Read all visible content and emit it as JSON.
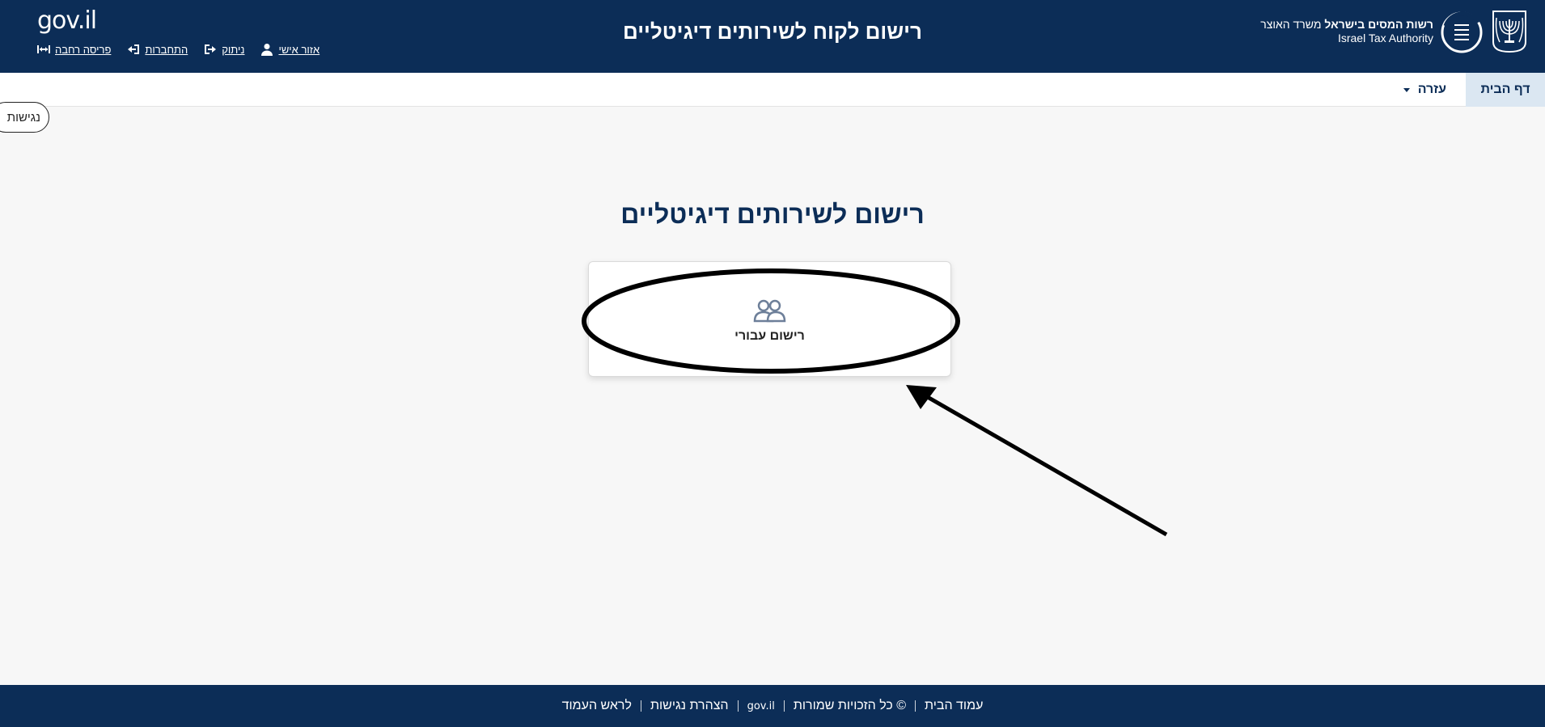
{
  "header": {
    "title": "רישום לקוח לשירותים דיגיטליים",
    "authority_he_bold": "רשות המסים בישראל",
    "authority_he_rest": "משרד האוצר",
    "authority_en": "Israel Tax Authority",
    "logo_text": "gov.il",
    "links": {
      "personal_area": "אזור אישי",
      "logout": "ניתוק",
      "login": "התחברות",
      "wide_layout": "פריסה רחבה"
    }
  },
  "nav": {
    "home": "דף הבית",
    "help": "עזרה"
  },
  "accessibility_button": "נגישות",
  "main": {
    "title": "רישום לשירותים דיגיטליים",
    "card_label": "רישום עבורי"
  },
  "footer": {
    "home": "עמוד הבית",
    "copyright": "© כל הזכויות שמורות",
    "govil": "gov.il",
    "accessibility": "הצהרת נגישות",
    "top": "לראש העמוד"
  },
  "colors": {
    "primary": "#0c2d57",
    "nav_active": "#dbe7f2",
    "background": "#f7f7f7"
  }
}
